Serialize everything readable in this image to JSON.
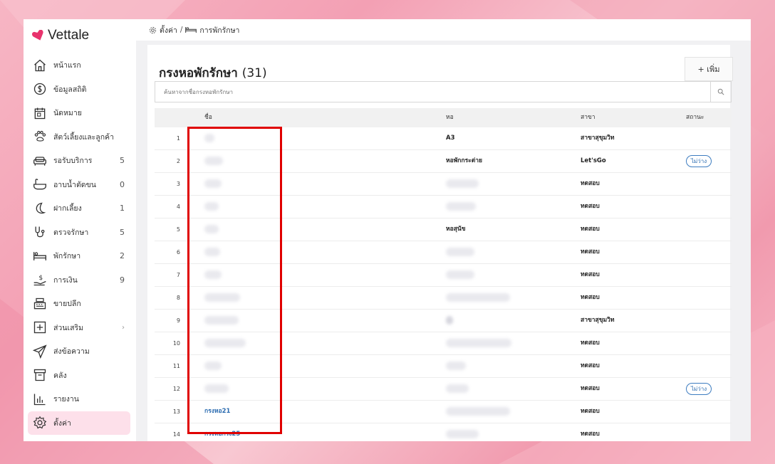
{
  "app": {
    "brand": "Vettale",
    "brand_color": "#e8336d"
  },
  "breadcrumb": {
    "settings": "ตั้งค่า",
    "separator": "/",
    "page": "การพักรักษา"
  },
  "sidebar": {
    "items": [
      {
        "label": "หน้าแรก",
        "icon": "home-icon",
        "count": ""
      },
      {
        "label": "ข้อมูลสถิติ",
        "icon": "dollar-circle-icon",
        "count": ""
      },
      {
        "label": "นัดหมาย",
        "icon": "calendar-icon",
        "count": ""
      },
      {
        "label": "สัตว์เลี้ยงและลูกค้า",
        "icon": "paw-icon",
        "count": ""
      },
      {
        "label": "รอรับบริการ",
        "icon": "sofa-icon",
        "count": "5"
      },
      {
        "label": "อาบน้ำตัดขน",
        "icon": "bathtub-icon",
        "count": "0"
      },
      {
        "label": "ฝากเลี้ยง",
        "icon": "moon-icon",
        "count": "1"
      },
      {
        "label": "ตรวจรักษา",
        "icon": "stethoscope-icon",
        "count": "5"
      },
      {
        "label": "พักรักษา",
        "icon": "bed-icon",
        "count": "2"
      },
      {
        "label": "การเงิน",
        "icon": "money-hand-icon",
        "count": "9"
      },
      {
        "label": "ขายปลีก",
        "icon": "cash-register-icon",
        "count": ""
      },
      {
        "label": "ส่วนเสริม",
        "icon": "plus-square-icon",
        "count": "",
        "chevron": "›"
      },
      {
        "label": "ส่งข้อความ",
        "icon": "send-icon",
        "count": ""
      },
      {
        "label": "คลัง",
        "icon": "archive-icon",
        "count": ""
      },
      {
        "label": "รายงาน",
        "icon": "bar-chart-icon",
        "count": ""
      },
      {
        "label": "ตั้งค่า",
        "icon": "gear-icon",
        "count": "",
        "active": true
      }
    ]
  },
  "main": {
    "title": "กรงหอพักรักษา",
    "title_count": "(31)",
    "add_button": "+ เพิ่ม",
    "search_placeholder": "ค้นหาจากชื่อกรงหอพักรักษา",
    "columns": {
      "name": "ชื่อ",
      "dorm": "หอ",
      "branch": "สาขา",
      "status": "สถานะ"
    },
    "status_busy": "ไม่ว่าง",
    "rows": [
      {
        "no": "1",
        "name": "",
        "dorm": "A3",
        "branch": "สาขาสุขุมวิท",
        "status": ""
      },
      {
        "no": "2",
        "name": "",
        "dorm": "หอพักกระต่าย",
        "branch": "Let'sGo",
        "status": "ไม่ว่าง"
      },
      {
        "no": "3",
        "name": "",
        "dorm": "",
        "branch": "ทดสอบ",
        "status": ""
      },
      {
        "no": "4",
        "name": "",
        "dorm": "",
        "branch": "ทดสอบ",
        "status": ""
      },
      {
        "no": "5",
        "name": "",
        "dorm": "หอสุนัข",
        "branch": "ทดสอบ",
        "status": ""
      },
      {
        "no": "6",
        "name": "",
        "dorm": "",
        "branch": "ทดสอบ",
        "status": ""
      },
      {
        "no": "7",
        "name": "",
        "dorm": "",
        "branch": "ทดสอบ",
        "status": ""
      },
      {
        "no": "8",
        "name": "",
        "dorm": "",
        "branch": "ทดสอบ",
        "status": ""
      },
      {
        "no": "9",
        "name": "",
        "dorm": "",
        "branch": "สาขาสุขุมวิท",
        "status": ""
      },
      {
        "no": "10",
        "name": "",
        "dorm": "",
        "branch": "ทดสอบ",
        "status": ""
      },
      {
        "no": "11",
        "name": "",
        "dorm": "",
        "branch": "ทดสอบ",
        "status": ""
      },
      {
        "no": "12",
        "name": "",
        "dorm": "",
        "branch": "ทดสอบ",
        "status": "ไม่ว่าง"
      },
      {
        "no": "13",
        "name": "กรงหอ21",
        "dorm": "",
        "branch": "ทดสอบ",
        "status": ""
      },
      {
        "no": "14",
        "name": "กรงหอกรง25",
        "dorm": "",
        "branch": "ทดสอบ",
        "status": ""
      }
    ]
  },
  "highlight_color": "#e00000"
}
